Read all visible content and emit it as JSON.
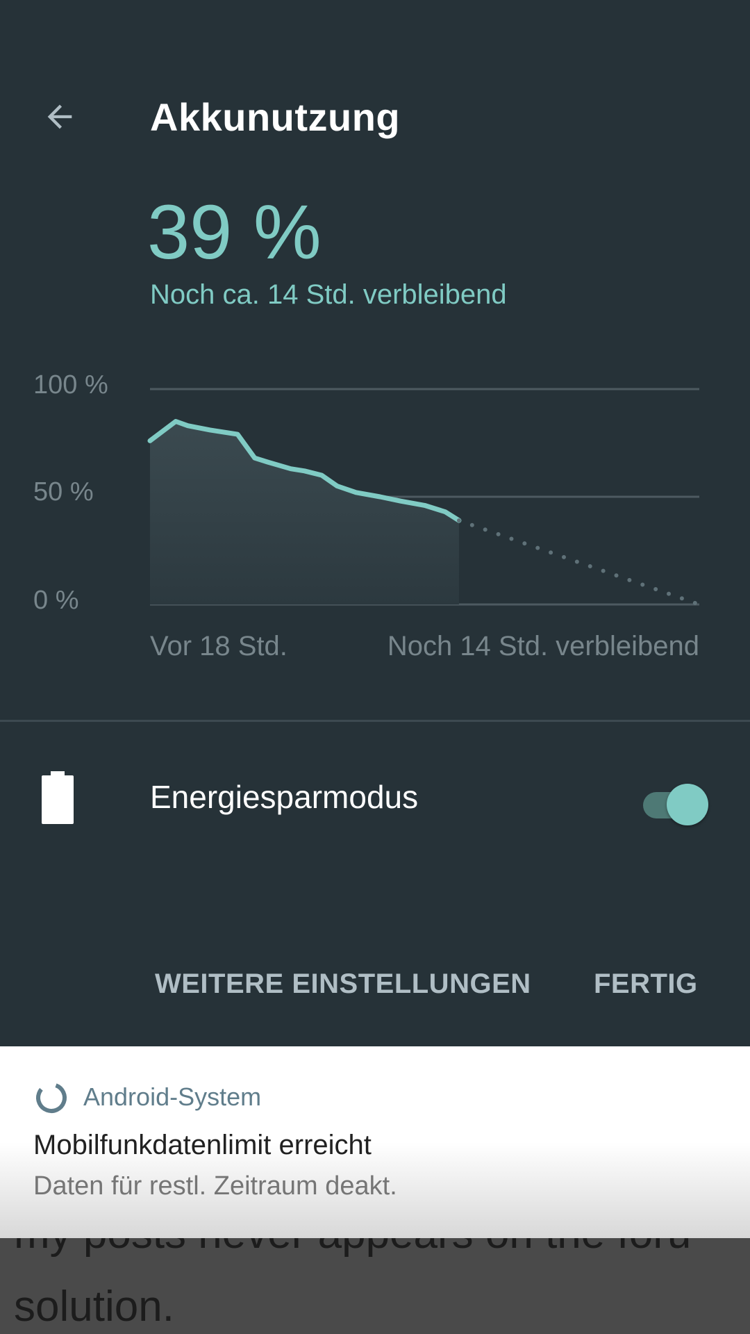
{
  "header": {
    "title": "Akkunutzung",
    "back_icon": "arrow-back-icon"
  },
  "battery": {
    "percent": "39 %",
    "remaining": "Noch ca. 14 Std. verbleibend"
  },
  "chart_data": {
    "type": "area",
    "y_ticks": [
      "100 %",
      "50 %",
      "0 %"
    ],
    "ylim": [
      0,
      100
    ],
    "x_start_label": "Vor 18 Std.",
    "x_end_label": "Noch 14 Std. verbleibend",
    "x_range_hours": [
      -18,
      14
    ],
    "history": {
      "x": [
        -18,
        -16.5,
        -15.8,
        -14.5,
        -12.9,
        -11.9,
        -11.1,
        -9.8,
        -9.0,
        -8.0,
        -7.1,
        -6.0,
        -4.6,
        -3.4,
        -2.0,
        -0.8,
        0
      ],
      "y": [
        76,
        85,
        83,
        81,
        79,
        68,
        66,
        63,
        62,
        60,
        55,
        52,
        50,
        48,
        46,
        43,
        39
      ]
    },
    "projection": {
      "x": [
        0,
        14
      ],
      "y": [
        39,
        0
      ]
    },
    "grid": true,
    "colors": {
      "line": "#80cbc4",
      "grid": "#4d5a61",
      "projection": "#5f7178"
    }
  },
  "saver": {
    "label": "Energiesparmodus",
    "icon": "battery-icon",
    "enabled": true
  },
  "actions": {
    "more_settings": "WEITERE EINSTELLUNGEN",
    "done": "FERTIG"
  },
  "notification": {
    "app": "Android-System",
    "icon": "sync-icon",
    "title": "Mobilfunkdatenlimit erreicht",
    "text": "Daten für restl. Zeitraum deakt."
  },
  "background": {
    "line1": "my posts never appears on the foru",
    "line2": "solution."
  },
  "colors": {
    "panel": "#263238",
    "accent": "#80cbc4"
  }
}
